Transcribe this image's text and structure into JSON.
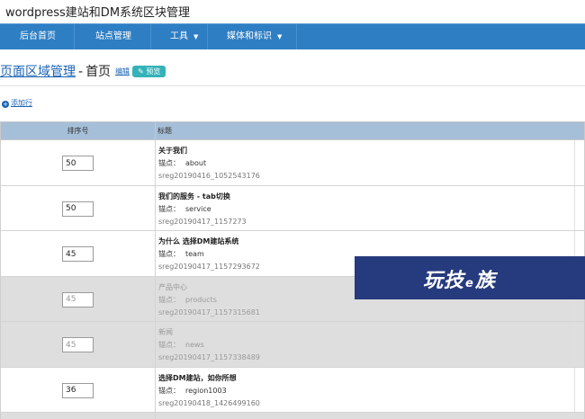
{
  "site": {
    "title": "wordpress建站和DM系统区块管理"
  },
  "nav": {
    "items": [
      {
        "label": "后台首页"
      },
      {
        "label": "站点管理"
      },
      {
        "label": "工具",
        "caret": "▼"
      },
      {
        "label": "媒体和标识",
        "caret": "▼"
      }
    ]
  },
  "page": {
    "area_link": "页面区域管理",
    "separator": "-",
    "page_name": "首页",
    "edit_label": "编辑",
    "preview_label": "✎ 预览"
  },
  "actions": {
    "add_label": "添加行",
    "add_icon": "plus-circle-icon"
  },
  "table": {
    "headers": {
      "order": "排序号",
      "title": "标题"
    },
    "rows": [
      {
        "order": "50",
        "title": "关于我们",
        "anchor_label": "锚点：",
        "anchor": "about",
        "id": "sreg20190416_1052543176",
        "disabled": false
      },
      {
        "order": "50",
        "title": "我们的服务 - tab切换",
        "anchor_label": "锚点：",
        "anchor": "service",
        "id": "sreg20190417_1157273",
        "disabled": false
      },
      {
        "order": "45",
        "title": "为什么 选择DM建站系统",
        "anchor_label": "锚点：",
        "anchor": "team",
        "id": "sreg20190417_1157293672",
        "disabled": false
      },
      {
        "order": "45",
        "title": "产品中心",
        "anchor_label": "锚点：",
        "anchor": "products",
        "id": "sreg20190417_1157315681",
        "disabled": true
      },
      {
        "order": "45",
        "title": "新闻",
        "anchor_label": "锚点：",
        "anchor": "news",
        "id": "sreg20190417_1157338489",
        "disabled": true
      },
      {
        "order": "36",
        "title": "选择DM建站，如你所想",
        "anchor_label": "锚点：",
        "anchor": "region1003",
        "id": "sreg20190418_1426499160",
        "disabled": false
      }
    ]
  },
  "watermark": {
    "text_a": "玩技",
    "text_e": "e",
    "text_b": "族",
    "bg_color": "#263a7e"
  },
  "colors": {
    "navbar": "#2e7ec4",
    "table_header": "#a6bfd8",
    "link": "#1a63b5",
    "preview": "#35b2b8",
    "disabled_row": "#dedede"
  }
}
